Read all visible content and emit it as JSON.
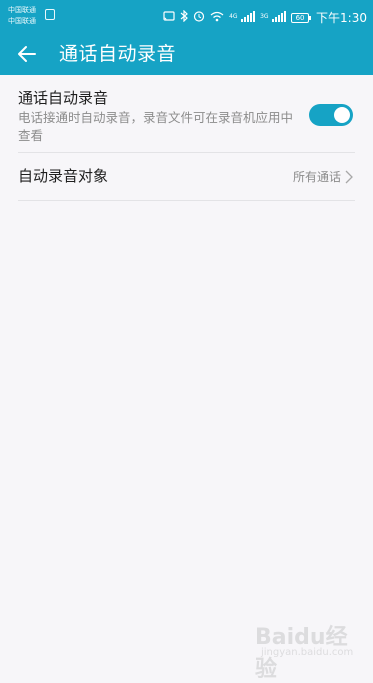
{
  "status_bar": {
    "carrier_1": "中国联通",
    "carrier_2": "中国联通",
    "time": "下午1:30",
    "battery": "60",
    "net_1": "4G",
    "net_2": "3G"
  },
  "toolbar": {
    "title": "通话自动录音"
  },
  "settings": {
    "auto_record": {
      "title": "通话自动录音",
      "description": "电话接通时自动录音，录音文件可在录音机应用中查看",
      "enabled": true
    },
    "record_target": {
      "title": "自动录音对象",
      "value": "所有通话"
    }
  },
  "watermark": {
    "text": "Baidu经验",
    "sub": "jingyan.baidu.com"
  },
  "colors": {
    "accent": "#16a3c5",
    "background": "#f7f6f9"
  }
}
